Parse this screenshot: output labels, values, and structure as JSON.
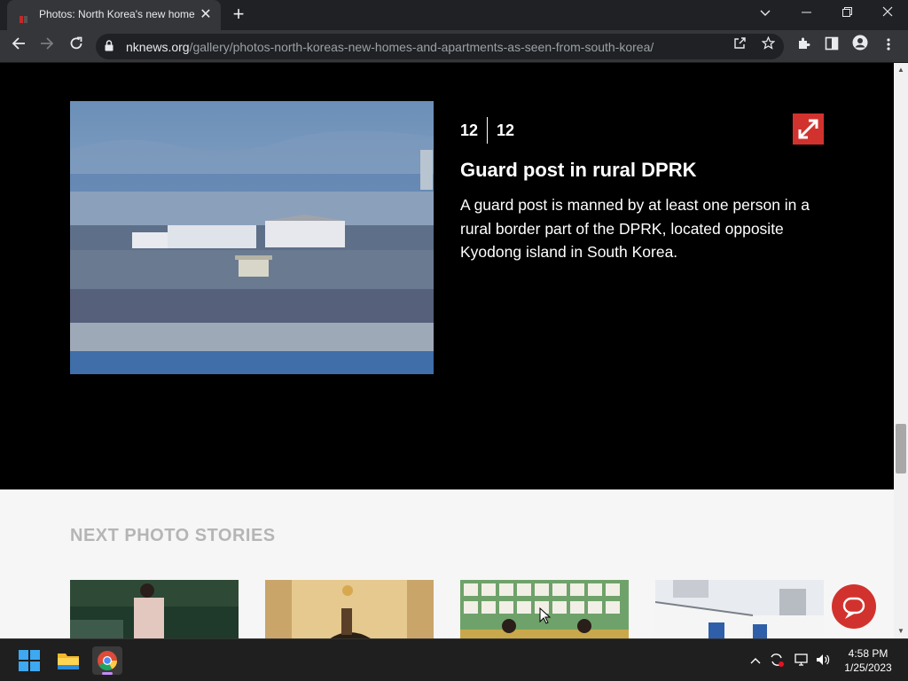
{
  "browser": {
    "tab_title": "Photos: North Korea's new home",
    "tab_close": "✕",
    "new_tab": "+",
    "url_host": "nknews.org",
    "url_path": "/gallery/photos-north-koreas-new-homes-and-apartments-as-seen-from-south-korea/",
    "window_controls": {
      "dropdown": "⌄",
      "minimize": "—",
      "restore": "❐",
      "close": "✕"
    }
  },
  "gallery": {
    "current_index": "12",
    "total": "12",
    "caption_title": "Guard post in rural DPRK",
    "caption_text": "A guard post is manned by at least one person in a rural border part of the DPRK, located opposite Kyodong island in South Korea."
  },
  "next_stories": {
    "heading": "NEXT PHOTO STORIES",
    "thumbnails": [
      {
        "name": "story-thumb-woman"
      },
      {
        "name": "story-thumb-statue"
      },
      {
        "name": "story-thumb-shop"
      },
      {
        "name": "story-thumb-buildings"
      }
    ]
  },
  "taskbar": {
    "time": "4:58 PM",
    "date": "1/25/2023"
  },
  "colors": {
    "accent_red": "#d2322d",
    "page_dark": "#000000",
    "page_light": "#f6f6f6",
    "heading_gray": "#b5b5b5"
  },
  "icons": [
    "back-icon",
    "forward-icon",
    "reload-icon",
    "lock-icon",
    "share-icon",
    "star-icon",
    "extensions-icon",
    "sidepanel-icon",
    "profile-icon",
    "menu-icon",
    "expand-icon",
    "chat-icon"
  ]
}
